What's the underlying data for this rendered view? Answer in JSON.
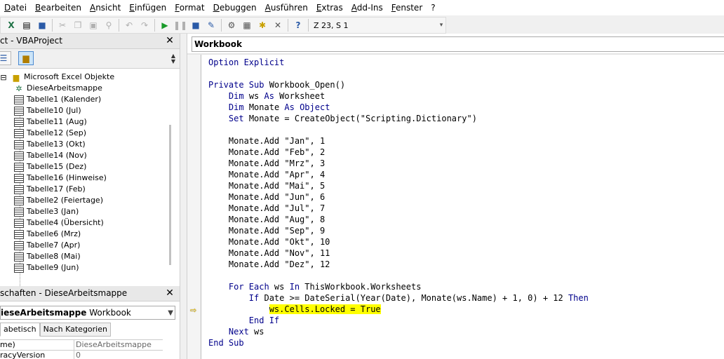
{
  "menubar": {
    "items": [
      "Datei",
      "Bearbeiten",
      "Ansicht",
      "Einfügen",
      "Format",
      "Debuggen",
      "Ausführen",
      "Extras",
      "Add-Ins",
      "Fenster",
      "?"
    ]
  },
  "toolbar": {
    "cursor_position": "Z 23, S 1"
  },
  "project": {
    "title": "ct - VBAProject",
    "folder": "Microsoft Excel Objekte",
    "items": [
      {
        "label": "DieseArbeitsmappe",
        "icon": "workbook-icon"
      },
      {
        "label": "Tabelle1 (Kalender)",
        "icon": "sheet-icon"
      },
      {
        "label": "Tabelle10 (Jul)",
        "icon": "sheet-icon"
      },
      {
        "label": "Tabelle11 (Aug)",
        "icon": "sheet-icon"
      },
      {
        "label": "Tabelle12 (Sep)",
        "icon": "sheet-icon"
      },
      {
        "label": "Tabelle13 (Okt)",
        "icon": "sheet-icon"
      },
      {
        "label": "Tabelle14 (Nov)",
        "icon": "sheet-icon"
      },
      {
        "label": "Tabelle15 (Dez)",
        "icon": "sheet-icon"
      },
      {
        "label": "Tabelle16 (Hinweise)",
        "icon": "sheet-icon"
      },
      {
        "label": "Tabelle17 (Feb)",
        "icon": "sheet-icon"
      },
      {
        "label": "Tabelle2 (Feiertage)",
        "icon": "sheet-icon"
      },
      {
        "label": "Tabelle3 (Jan)",
        "icon": "sheet-icon"
      },
      {
        "label": "Tabelle4 (Übersicht)",
        "icon": "sheet-icon"
      },
      {
        "label": "Tabelle6 (Mrz)",
        "icon": "sheet-icon"
      },
      {
        "label": "Tabelle7 (Apr)",
        "icon": "sheet-icon"
      },
      {
        "label": "Tabelle8 (Mai)",
        "icon": "sheet-icon"
      },
      {
        "label": "Tabelle9 (Jun)",
        "icon": "sheet-icon"
      }
    ]
  },
  "properties": {
    "title": "schaften - DieseArbeitsmappe",
    "object_name": "ieseArbeitsmappe",
    "object_type": "Workbook",
    "tabs": [
      "abetisch",
      "Nach Kategorien"
    ],
    "rows": [
      {
        "name": "me)",
        "value": "DieseArbeitsmappe"
      },
      {
        "name": "racyVersion",
        "value": "0"
      }
    ]
  },
  "code": {
    "object": "Workbook",
    "lines": [
      [
        {
          "t": "Option Explicit",
          "c": "kw"
        }
      ],
      [],
      [
        {
          "t": "Private Sub",
          "c": "kw"
        },
        {
          "t": " Workbook_Open()"
        }
      ],
      [
        {
          "t": "    "
        },
        {
          "t": "Dim",
          "c": "kw"
        },
        {
          "t": " ws "
        },
        {
          "t": "As",
          "c": "kw"
        },
        {
          "t": " Worksheet"
        }
      ],
      [
        {
          "t": "    "
        },
        {
          "t": "Dim",
          "c": "kw"
        },
        {
          "t": " Monate "
        },
        {
          "t": "As Object",
          "c": "kw"
        }
      ],
      [
        {
          "t": "    "
        },
        {
          "t": "Set",
          "c": "kw"
        },
        {
          "t": " Monate = CreateObject(\"Scripting.Dictionary\")"
        }
      ],
      [],
      [
        {
          "t": "    Monate.Add \"Jan\", 1"
        }
      ],
      [
        {
          "t": "    Monate.Add \"Feb\", 2"
        }
      ],
      [
        {
          "t": "    Monate.Add \"Mrz\", 3"
        }
      ],
      [
        {
          "t": "    Monate.Add \"Apr\", 4"
        }
      ],
      [
        {
          "t": "    Monate.Add \"Mai\", 5"
        }
      ],
      [
        {
          "t": "    Monate.Add \"Jun\", 6"
        }
      ],
      [
        {
          "t": "    Monate.Add \"Jul\", 7"
        }
      ],
      [
        {
          "t": "    Monate.Add \"Aug\", 8"
        }
      ],
      [
        {
          "t": "    Monate.Add \"Sep\", 9"
        }
      ],
      [
        {
          "t": "    Monate.Add \"Okt\", 10"
        }
      ],
      [
        {
          "t": "    Monate.Add \"Nov\", 11"
        }
      ],
      [
        {
          "t": "    Monate.Add \"Dez\", 12"
        }
      ],
      [],
      [
        {
          "t": "    "
        },
        {
          "t": "For Each",
          "c": "kw"
        },
        {
          "t": " ws "
        },
        {
          "t": "In",
          "c": "kw"
        },
        {
          "t": " ThisWorkbook.Worksheets"
        }
      ],
      [
        {
          "t": "        "
        },
        {
          "t": "If",
          "c": "kw"
        },
        {
          "t": " Date >= DateSerial(Year(Date), Monate(ws.Name) + 1, 0) + 12 "
        },
        {
          "t": "Then",
          "c": "kw"
        }
      ],
      [
        {
          "t": "            "
        },
        {
          "t": "ws.Cells.Locked = True",
          "c": "hl"
        }
      ],
      [
        {
          "t": "        "
        },
        {
          "t": "End If",
          "c": "kw"
        }
      ],
      [
        {
          "t": "    "
        },
        {
          "t": "Next",
          "c": "kw"
        },
        {
          "t": " ws"
        }
      ],
      [
        {
          "t": "End Sub",
          "c": "kw"
        }
      ]
    ]
  },
  "colors": {
    "keyword": "#00008b",
    "highlight": "#ffff00",
    "execution_arrow": "#f0c300"
  }
}
